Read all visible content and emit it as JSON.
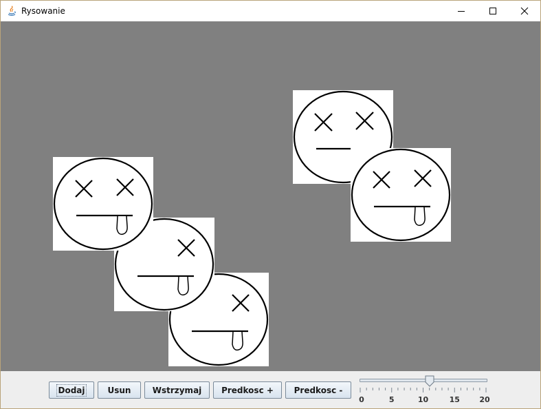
{
  "window": {
    "title": "Rysowanie",
    "controls": {
      "minimize_icon": "minimize-icon",
      "maximize_icon": "maximize-icon",
      "close_icon": "close-icon"
    }
  },
  "canvas": {
    "background_color": "#808080",
    "face_count": 5
  },
  "toolbar": {
    "buttons": [
      {
        "label": "Dodaj"
      },
      {
        "label": "Usun"
      },
      {
        "label": "Wstrzymaj"
      },
      {
        "label": "Predkosc +"
      },
      {
        "label": "Predkosc -"
      }
    ]
  },
  "speed_slider": {
    "min": 0,
    "max": 20,
    "value": 11,
    "tick_labels": [
      "0",
      "5",
      "10",
      "15",
      "20"
    ]
  }
}
